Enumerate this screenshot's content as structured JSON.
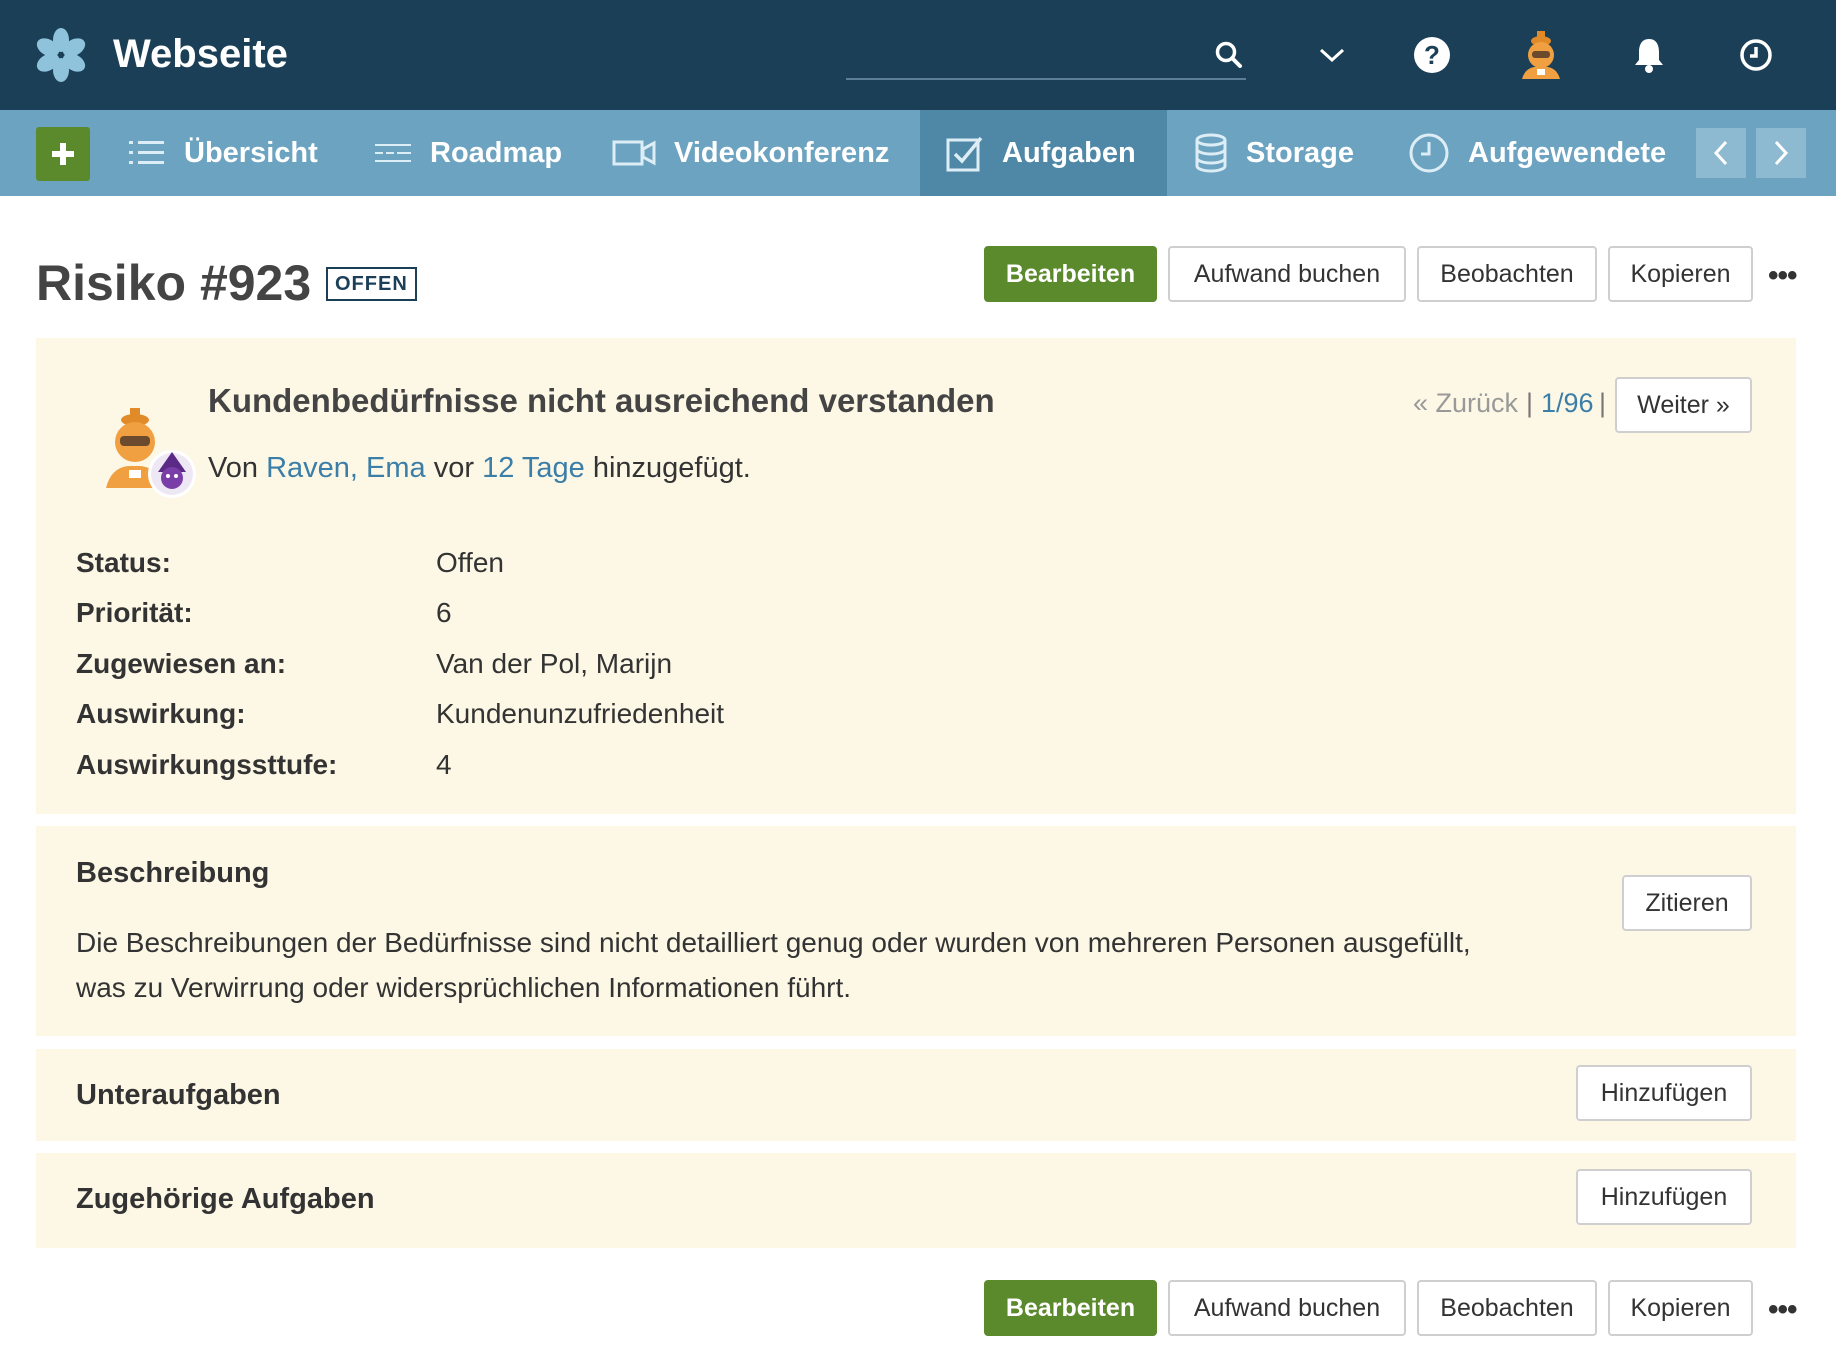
{
  "app": {
    "title": "Webseite"
  },
  "header": {
    "icons": [
      "logo-asterisk-icon",
      "search-icon",
      "chevron-down-icon",
      "help-icon",
      "user-avatar",
      "bell-icon",
      "clock-icon"
    ]
  },
  "nav": {
    "add_icon": "plus-icon",
    "items": [
      {
        "label": "Übersicht",
        "icon": "list-icon"
      },
      {
        "label": "Roadmap",
        "icon": "roadmap-icon"
      },
      {
        "label": "Videokonferenz",
        "icon": "video-icon"
      },
      {
        "label": "Aufgaben",
        "icon": "checkbox-icon",
        "active": true
      },
      {
        "label": "Storage",
        "icon": "database-icon"
      },
      {
        "label": "Aufgewendete",
        "icon": "clock-icon"
      }
    ]
  },
  "issue": {
    "title": "Risiko #923",
    "status_badge": "OFFEN",
    "subject": "Kundenbedürfnisse nicht ausreichend verstanden",
    "author": {
      "prefix": "Von",
      "name": "Raven, Ema",
      "middle": "vor",
      "age": "12 Tage",
      "suffix": "hinzugefügt."
    },
    "pager": {
      "prev": "« Zurück",
      "sep": "|",
      "position": "1/96",
      "next": "Weiter »"
    },
    "attributes": [
      {
        "label": "Status:",
        "value": "Offen",
        "link": false
      },
      {
        "label": "Priorität:",
        "value": "6",
        "link": false
      },
      {
        "label": "Zugewiesen an:",
        "value": "Van der Pol, Marijn",
        "link": true
      },
      {
        "label": "Auswirkung:",
        "value": "Kundenunzufriedenheit",
        "link": false
      },
      {
        "label": "Auswirkungssttufe:",
        "value": "4",
        "link": false
      }
    ]
  },
  "actions": {
    "edit": "Bearbeiten",
    "log_time": "Aufwand buchen",
    "watch": "Beobachten",
    "copy": "Kopieren",
    "more": "•••"
  },
  "description": {
    "heading": "Beschreibung",
    "quote_button": "Zitieren",
    "text_line1": "Die Beschreibungen der Bedürfnisse sind nicht detailliert genug oder wurden von mehreren Personen ausgefüllt,",
    "text_line2": "was zu Verwirrung oder widersprüchlichen Informationen führt."
  },
  "subtasks": {
    "heading": "Unteraufgaben",
    "add_button": "Hinzufügen"
  },
  "related": {
    "heading": "Zugehörige Aufgaben",
    "add_button": "Hinzufügen"
  },
  "colors": {
    "header_bg": "#1b3f57",
    "nav_bg": "#6ca3c1",
    "nav_active_bg": "#4f87a6",
    "primary_green": "#5a8a2b",
    "card_bg": "#fdf8e6",
    "link": "#3b7ea7"
  }
}
